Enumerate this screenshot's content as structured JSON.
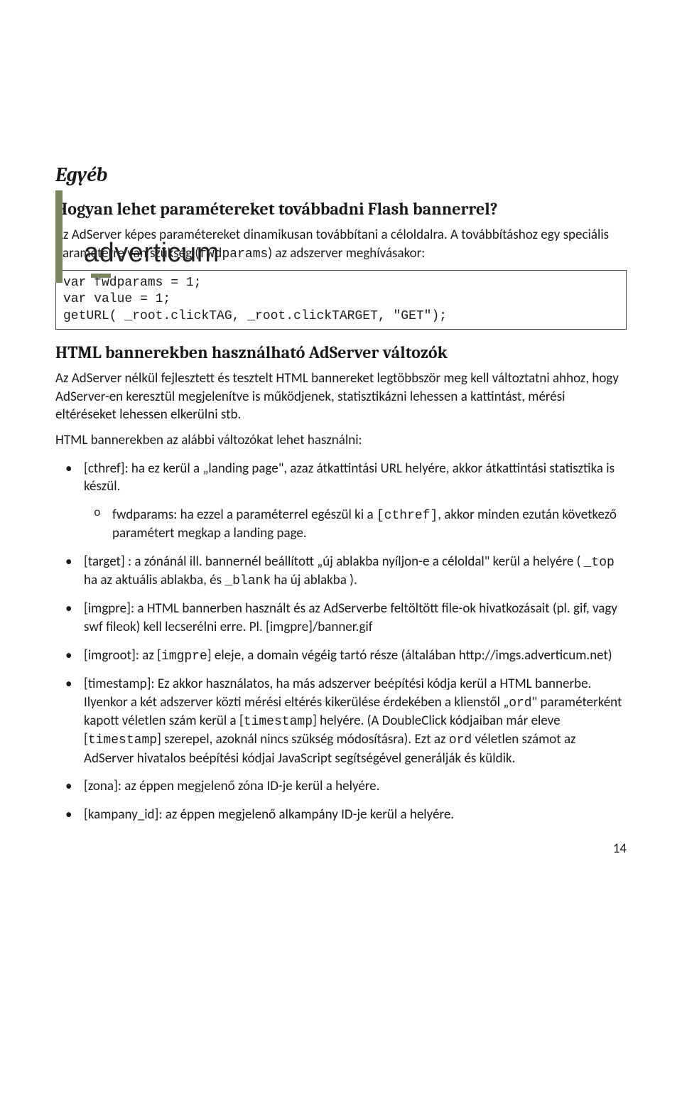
{
  "logo": "adverticum",
  "section": "Egyéb",
  "q1": {
    "title": "Hogyan lehet paramétereket továbbadni Flash bannerrel?",
    "p1_a": "Az AdServer képes paramétereket dinamikusan továbbítani a céloldalra. A továbbításhoz egy speciális paraméterre van szükség (",
    "p1_code": "fwdparams",
    "p1_b": ") az adszerver meghívásakor:",
    "code": "var fwdparams = 1;\nvar value = 1;\ngetURL( _root.clickTAG, _root.clickTARGET, \"GET\");"
  },
  "q2": {
    "title": "HTML bannerekben használható AdServer változók",
    "p1": "Az AdServer nélkül fejlesztett és tesztelt HTML bannereket legtöbbször meg kell változtatni ahhoz, hogy AdServer-en keresztül megjelenítve is működjenek, statisztikázni lehessen a kattintást, mérési eltéréseket lehessen elkerülni stb.",
    "p2": "HTML bannerekben az alábbi változókat lehet használni:",
    "bullets": [
      {
        "text": "[cthref]: ha ez kerül a „landing page\", azaz átkattintási URL helyére, akkor átkattintási statisztika is készül.",
        "sub": {
          "a": "fwdparams: ha ezzel a paraméterrel egészül ki a ",
          "code": "[cthref]",
          "b": ", akkor minden ezután következő paramétert megkap a landing page."
        }
      },
      {
        "a": "[target] : a zónánál ill. bannernél beállított „új ablakba nyíljon-e a céloldal\" kerül a helyére ( ",
        "code1": "_top",
        "b": " ha az aktuális ablakba, és ",
        "code2": "_blank",
        "c": " ha új ablakba )."
      },
      {
        "text": "[imgpre]: a HTML bannerben használt és az AdServerbe feltöltött file-ok hivatkozásait (pl. gif, vagy swf fileok) kell lecserélni erre. Pl. [imgpre]/banner.gif"
      },
      {
        "a": "[imgroot]: az [",
        "code": "imgpre",
        "b": "] eleje, a domain végéig tartó része (általában http://imgs.adverticum.net)"
      },
      {
        "a": "[timestamp]: Ez akkor használatos, ha más adszerver beépítési kódja kerül a HTML bannerbe. Ilyenkor a két adszerver közti mérési eltérés kikerülése érdekében a klienstől „",
        "code1": "ord",
        "b": "\" paraméterként kapott véletlen szám kerül a [",
        "code2": "timestamp",
        "c": "] helyére. (A DoubleClick kódjaiban már eleve [",
        "code3": "timestamp",
        "d": "] szerepel, azoknál nincs szükség módosításra). Ezt az ",
        "code4": "ord",
        "e": " véletlen számot az AdServer hivatalos beépítési kódjai JavaScript segítségével generálják és küldik."
      },
      {
        "text": "[zona]: az éppen megjelenő zóna ID-je kerül a helyére."
      },
      {
        "text": "[kampany_id]: az éppen megjelenő alkampány ID-je kerül a helyére."
      }
    ]
  },
  "pagenum": "14"
}
